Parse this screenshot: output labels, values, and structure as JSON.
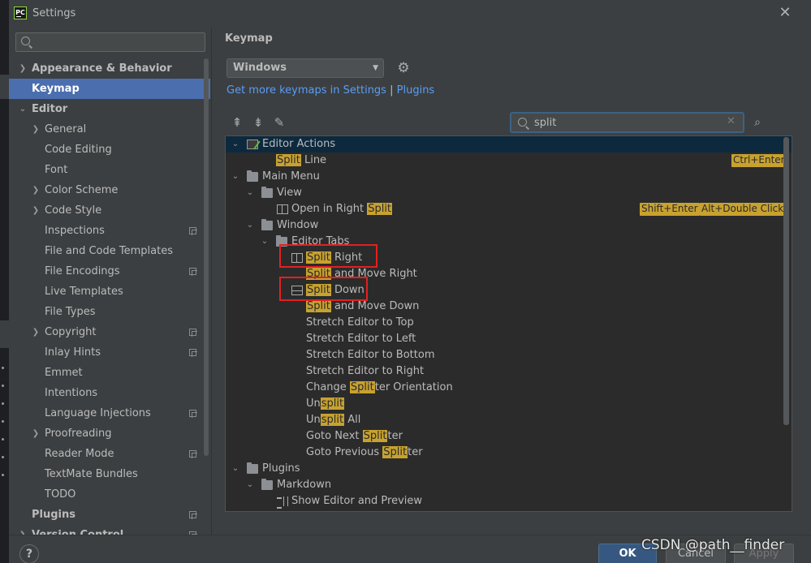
{
  "window": {
    "title": "Settings",
    "app_icon_text": "PC"
  },
  "left": {
    "search_placeholder": "",
    "items": [
      {
        "label": "Appearance & Behavior"
      },
      {
        "label": "Keymap"
      },
      {
        "label": "Editor"
      },
      {
        "label": "General"
      },
      {
        "label": "Code Editing"
      },
      {
        "label": "Font"
      },
      {
        "label": "Color Scheme"
      },
      {
        "label": "Code Style"
      },
      {
        "label": "Inspections"
      },
      {
        "label": "File and Code Templates"
      },
      {
        "label": "File Encodings"
      },
      {
        "label": "Live Templates"
      },
      {
        "label": "File Types"
      },
      {
        "label": "Copyright"
      },
      {
        "label": "Inlay Hints"
      },
      {
        "label": "Emmet"
      },
      {
        "label": "Intentions"
      },
      {
        "label": "Language Injections"
      },
      {
        "label": "Proofreading"
      },
      {
        "label": "Reader Mode"
      },
      {
        "label": "TextMate Bundles"
      },
      {
        "label": "TODO"
      },
      {
        "label": "Plugins"
      },
      {
        "label": "Version Control"
      }
    ]
  },
  "main": {
    "section_title": "Keymap",
    "keymap_value": "Windows",
    "link_left": "Get more keymaps in Settings",
    "link_sep": "|",
    "link_right": "Plugins",
    "filter_value": "split",
    "tree": {
      "editor_actions": "Editor Actions",
      "split_line": {
        "pre": "",
        "match": "Split",
        "post": " Line",
        "shortcut": "Ctrl+Enter"
      },
      "main_menu": "Main Menu",
      "view": "View",
      "open_in_right_split": {
        "pre": "Open in Right ",
        "match": "Split",
        "post": "",
        "shortcut1": "Shift+Enter",
        "shortcut2": "Alt+Double Click"
      },
      "window": "Window",
      "editor_tabs": "Editor Tabs",
      "split_right": {
        "pre": "",
        "match": "Split",
        "post": " Right"
      },
      "split_and_move_right": {
        "pre": "",
        "match": "Split",
        "post": " and Move Right"
      },
      "split_down": {
        "pre": "",
        "match": "Split",
        "post": " Down"
      },
      "split_and_move_down": {
        "pre": "",
        "match": "Split",
        "post": " and Move Down"
      },
      "stretch_top": "Stretch Editor to Top",
      "stretch_left": "Stretch Editor to Left",
      "stretch_bottom": "Stretch Editor to Bottom",
      "stretch_right": "Stretch Editor to Right",
      "change_orientation": {
        "pre": "Change ",
        "match": "Split",
        "post": "ter Orientation"
      },
      "unsplit": {
        "pre": "Un",
        "match": "split",
        "post": ""
      },
      "unsplit_all": {
        "pre": "Un",
        "match": "split",
        "post": " All"
      },
      "goto_next": {
        "pre": "Goto Next ",
        "match": "Split",
        "post": "ter"
      },
      "goto_prev": {
        "pre": "Goto Previous ",
        "match": "Split",
        "post": "ter"
      },
      "plugins": "Plugins",
      "markdown": "Markdown",
      "show_editor_preview": "Show Editor and Preview"
    }
  },
  "buttons": {
    "help": "?",
    "ok": "OK",
    "cancel": "Cancel",
    "apply": "Apply"
  },
  "watermark": "CSDN @path__finder",
  "colors": {
    "selection": "#4b6eaf",
    "highlight": "#c8a22f",
    "link": "#589df6",
    "annotation": "#e32020"
  }
}
